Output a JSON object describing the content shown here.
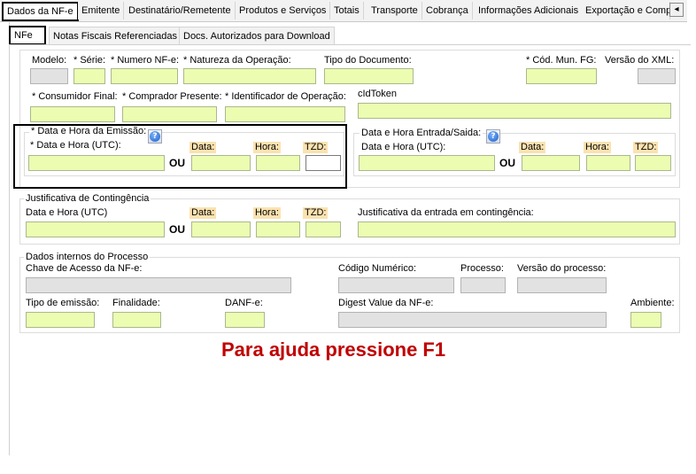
{
  "tabs": [
    "Dados da NF-e",
    "Emitente",
    "Destinatário/Remetente",
    "Produtos e Serviços",
    "Totais",
    "Transporte",
    "Cobrança",
    "Informações Adicionais",
    "Exportação e Compr"
  ],
  "tab_scroll_left": "◂",
  "subtabs": [
    "NFe",
    "Notas Fiscais Referenciadas",
    "Docs. Autorizados para Download"
  ],
  "nfe": {
    "modelo": "Modelo:",
    "serie": "* Série:",
    "numero": "* Numero NF-e:",
    "natureza": "* Natureza da Operação:",
    "tipo_doc": "Tipo do Documento:",
    "cod_mun": "* Cód. Mun. FG:",
    "versao_xml": "Versão do XML:",
    "consumidor": "* Consumidor Final:",
    "comprador": "* Comprador Presente:",
    "identificador": "* Identificador de Operação:",
    "cid_token": "cIdToken"
  },
  "emissao": {
    "title": "* Data e Hora da Emissão:",
    "utc_label": "* Data e Hora (UTC):",
    "data": "Data:",
    "hora": "Hora:",
    "tzd": "TZD:",
    "ou": "OU",
    "help": "?"
  },
  "entrada_saida": {
    "title": "Data e Hora Entrada/Saida:",
    "utc_label": "Data e Hora (UTC):",
    "data": "Data:",
    "hora": "Hora:",
    "tzd": "TZD:",
    "ou": "OU",
    "help": "?"
  },
  "contingencia": {
    "title": "Justificativa de Contingência",
    "utc_label": "Data e Hora (UTC)",
    "data": "Data:",
    "hora": "Hora:",
    "tzd": "TZD:",
    "ou": "OU",
    "justificativa": "Justificativa da entrada em contingência:"
  },
  "internos": {
    "title": "Dados internos do Processo",
    "chave": "Chave de Acesso da NF-e:",
    "codigo": "Código Numérico:",
    "processo": "Processo:",
    "versao_processo": "Versão do processo:",
    "tipo_emissao": "Tipo de emissão:",
    "finalidade": "Finalidade:",
    "danfe": "DANF-e:",
    "digest": "Digest Value da NF-e:",
    "ambiente": "Ambiente:"
  },
  "help_message": "Para ajuda pressione F1"
}
